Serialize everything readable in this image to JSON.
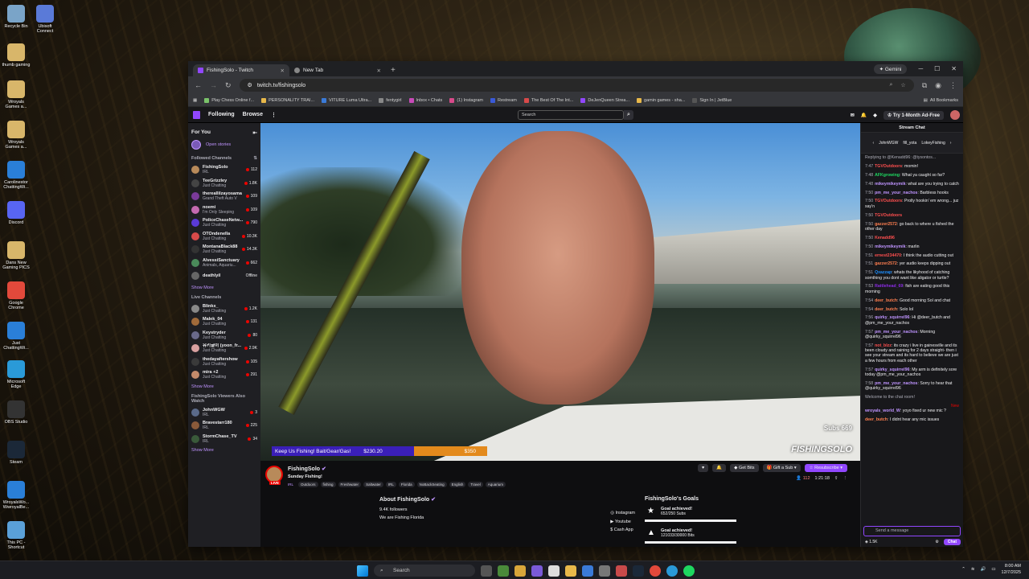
{
  "desktop": {
    "icons": [
      {
        "label": "Recycle Bin",
        "color": "#7aa4c8"
      },
      {
        "label": "Ubisoft Connect",
        "color": "#5a7ad8"
      },
      {
        "label": "thumb gaming",
        "color": "#d8b66a"
      },
      {
        "label": "Wroyals Games a...",
        "color": "#d8b66a"
      },
      {
        "label": "Wroyals Games a...",
        "color": "#d8b66a"
      },
      {
        "label": "Carolinestor ChattingWi...",
        "color": "#2a7fd8"
      },
      {
        "label": "Discord",
        "color": "#5865f2"
      },
      {
        "label": "Dans New Gaming PICS",
        "color": "#d8b66a"
      },
      {
        "label": "Google Chrome",
        "color": "#e2493b"
      },
      {
        "label": "Just ChattingWi...",
        "color": "#2a7fd8"
      },
      {
        "label": "Microsoft Edge",
        "color": "#2a9ad8"
      },
      {
        "label": "OBS Studio",
        "color": "#333"
      },
      {
        "label": "Steam",
        "color": "#1b2838"
      },
      {
        "label": "WroyalsWo... WwroyalBe...",
        "color": "#2a7fd8"
      },
      {
        "label": "This PC - Shortcut",
        "color": "#5aa0d8"
      }
    ]
  },
  "browser": {
    "tabs": [
      {
        "label": "FishingSolo - Twitch",
        "active": true
      },
      {
        "label": "New Tab",
        "active": false
      }
    ],
    "gemini_label": "Gemini",
    "url": "twitch.tv/fishingsolo",
    "bookmarks": [
      "Play Chess Online f...",
      "PERSONALITY TRAI...",
      "VITURE Luma Ultra...",
      "fentygirl",
      "Inbox • Chats",
      "(1) Instagram",
      "Restream",
      "The Best Of The Int...",
      "DeJenQueen Strea...",
      "gamin games - sha...",
      "Sign In | JetBlue"
    ],
    "all_bookmarks": "All Bookmarks"
  },
  "twitch": {
    "nav": {
      "following": "Following",
      "browse": "Browse",
      "search_placeholder": "Search",
      "ad_free": "Try 1-Month Ad-Free"
    },
    "sidebar": {
      "for_you": "For You",
      "open_stories": "Open stories",
      "followed_title": "Followed Channels",
      "followed": [
        {
          "name": "FishingSolo",
          "game": "IRL",
          "count": "112",
          "color": "#b88a5a"
        },
        {
          "name": "TeeGrizzley",
          "game": "Just Chatting",
          "count": "1.8K",
          "color": "#444"
        },
        {
          "name": "thereallilzayosama",
          "game": "Grand Theft Auto V",
          "count": "109",
          "color": "#7a3a9a"
        },
        {
          "name": "noemi",
          "game": "I'm Only Sleeping",
          "count": "109",
          "color": "#c46ab0"
        },
        {
          "name": "PoliceChaseNetw...",
          "game": "Just Chatting",
          "count": "790",
          "color": "#5a3ad8"
        },
        {
          "name": "OTOndenella",
          "game": "Just Chatting",
          "count": "10.3K",
          "color": "#d84a4a",
          "sub": "The Streamer A..."
        },
        {
          "name": "MontanaBlack88",
          "game": "Just Chatting",
          "count": "14.3K",
          "color": "#333"
        },
        {
          "name": "AlvessiSanctuary",
          "game": "Animals, Aquariu...",
          "count": "662",
          "color": "#4a8a5a"
        },
        {
          "name": "deathlyil",
          "game": "",
          "count": "Offline",
          "color": "#666"
        }
      ],
      "show_more": "Show More",
      "live_title": "Live Channels",
      "live": [
        {
          "name": "Blinkx_",
          "game": "Just Chatting",
          "count": "1.2K",
          "color": "#888"
        },
        {
          "name": "Malek_04",
          "game": "Just Chatting",
          "count": "131",
          "color": "#a06a3a"
        },
        {
          "name": "Keystryder",
          "game": "Just Chatting",
          "count": "80",
          "color": "#6a6a8a"
        },
        {
          "name": "유키글이 (yoon_fr...",
          "game": "Just Chatting",
          "count": "2.9K",
          "color": "#d8a0a0"
        },
        {
          "name": "thedayaftershow",
          "game": "Just Chatting",
          "count": "105",
          "color": "#3a3a3a"
        },
        {
          "name": "mira +2",
          "game": "Just Chatting",
          "count": "291",
          "color": "#c48a6a"
        }
      ],
      "also_title": "FishingSolo Viewers Also Watch",
      "also": [
        {
          "name": "JohnWGW",
          "game": "IRL",
          "count": "3",
          "color": "#5a6a8a"
        },
        {
          "name": "Bravestarr180",
          "game": "IRL",
          "count": "225",
          "color": "#8a5a3a"
        },
        {
          "name": "StormChase_TV",
          "game": "IRL",
          "count": "34",
          "color": "#3a5a3a"
        }
      ]
    },
    "video": {
      "goal_text": "Keep Us Fishing! Bait/Gear/Gas!",
      "goal_current": "$230.20",
      "goal_target": "$350",
      "goal_fraction": 0.66,
      "subs": "Subs 669",
      "watermark": "FISHINGSOLO"
    },
    "stream": {
      "name": "FishingSolo",
      "title": "Sunday Fishing!",
      "live": "LIVE",
      "category": "IRL",
      "tags": [
        "Outdoors",
        "fishing",
        "Freshwater",
        "Saltwater",
        "IRL",
        "Florida",
        "NoBackSeating",
        "English",
        "Travel",
        "Aquarium"
      ],
      "get_bits": "Get Bits",
      "gift_sub": "Gift a Sub",
      "resubscribe": "Resubscribe",
      "viewers": "112",
      "uptime": "1:21:18"
    },
    "about": {
      "title": "About FishingSolo",
      "followers": "9.4K followers",
      "description": "We are Fishing Florida",
      "links": [
        "Instagram",
        "Youtube",
        "Cash App"
      ]
    },
    "goals": {
      "title": "FishingSolo's Goals",
      "items": [
        {
          "label": "Goal achieved!",
          "detail": "652/250 Subs",
          "fraction": 1.0
        },
        {
          "label": "Goal achieved!",
          "detail": "121033/30000 Bits",
          "fraction": 1.0
        }
      ]
    },
    "chat": {
      "title": "Stream Chat",
      "pinned": [
        "JohnWGW",
        "fill_yota",
        "LokeyFishing"
      ],
      "messages": [
        {
          "t": "",
          "u": "",
          "c": "#adadb8",
          "m": "Replying to @Kenadd96: @tysontos..."
        },
        {
          "t": "7:47",
          "u": "TGVOutdoors",
          "c": "#ff4f4f",
          "m": "momin!"
        },
        {
          "t": "7:48",
          "u": "AFKgrowing",
          "c": "#1ed760",
          "m": "What ya caught so far?"
        },
        {
          "t": "7:48",
          "u": "mikeymikeymik",
          "c": "#bf94ff",
          "m": "what are you trying to catch"
        },
        {
          "t": "7:50",
          "u": "pm_me_your_nachos",
          "c": "#bf94ff",
          "m": "Barbless hooks"
        },
        {
          "t": "7:50",
          "u": "TGVOutdoors",
          "c": "#ff4f4f",
          "m": "Prolly hookin' em wrong... juz say'n"
        },
        {
          "t": "7:50",
          "u": "TGVOutdoors",
          "c": "#ff4f4f",
          "m": ""
        },
        {
          "t": "7:50",
          "u": "gazzer2572",
          "c": "#ff7f50",
          "m": "go back to where u fished the other day"
        },
        {
          "t": "7:50",
          "u": "Kenadd96",
          "c": "#ff4f4f",
          "m": ""
        },
        {
          "t": "7:50",
          "u": "mikeymikeymik",
          "c": "#bf94ff",
          "m": "marlin"
        },
        {
          "t": "7:51",
          "u": "ernest234470",
          "c": "#ff4f4f",
          "m": "I think the audio cutting out"
        },
        {
          "t": "7:51",
          "u": "gazzer2572",
          "c": "#ff7f50",
          "m": "yer audio keeps dipping out"
        },
        {
          "t": "7:51",
          "u": "Qxazzap",
          "c": "#1e90ff",
          "m": "whats the likyhood of catching somthing you dont want like aligator or turtle?"
        },
        {
          "t": "7:53",
          "u": "Rattlehead_69",
          "c": "#8a2be2",
          "m": "fish are eating good this morning"
        },
        {
          "t": "7:54",
          "u": "deer_butch",
          "c": "#ff7f50",
          "m": "Good morning Sol and chat"
        },
        {
          "t": "7:54",
          "u": "deer_butch",
          "c": "#ff7f50",
          "m": "Solo lol"
        },
        {
          "t": "7:56",
          "u": "quirky_squirrel96",
          "c": "#bf94ff",
          "m": "Hi @deer_butch and @pm_me_your_nachos"
        },
        {
          "t": "7:57",
          "u": "pm_me_your_nachos",
          "c": "#bf94ff",
          "m": "Morning @quirky_squirrel96"
        },
        {
          "t": "7:57",
          "u": "not_blzz",
          "c": "#ff4f4f",
          "m": "its crazy i live in gainesville and its been cloudy and raining for 2 days straight- then i see your stream and its hard to believe we are just a few hours from each other"
        },
        {
          "t": "7:57",
          "u": "quirky_squirrel96",
          "c": "#bf94ff",
          "m": "My arm is definitely sore today @pm_me_your_nachos"
        },
        {
          "t": "7:58",
          "u": "pm_me_your_nachos",
          "c": "#bf94ff",
          "m": "Sorry to hear that @quirky_squirrel96"
        }
      ],
      "welcome": "Welcome to the chat room!",
      "new_label": "New",
      "after_new": [
        {
          "t": "",
          "u": "wroyals_world_W",
          "c": "#bf94ff",
          "m": "yoyo fixed ur new mic ?"
        },
        {
          "t": "",
          "u": "deer_butch",
          "c": "#ff7f50",
          "m": "I didnt hear any mic issues"
        }
      ],
      "input_placeholder": "Send a message",
      "points": "1.5K",
      "chat_button": "Chat"
    }
  },
  "taskbar": {
    "search_placeholder": "Search",
    "time": "8:00 AM",
    "date": "12/7/2025"
  }
}
